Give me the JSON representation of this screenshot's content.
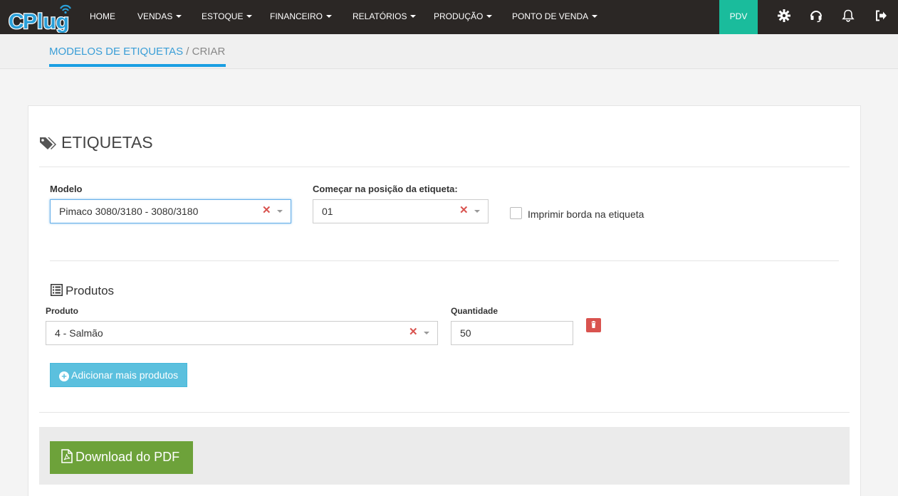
{
  "brand": {
    "logo_text": "CPlug"
  },
  "nav": {
    "items": [
      {
        "label": "HOME",
        "dropdown": false
      },
      {
        "label": "VENDAS",
        "dropdown": true
      },
      {
        "label": "ESTOQUE",
        "dropdown": true
      },
      {
        "label": "FINANCEIRO",
        "dropdown": true
      },
      {
        "label": "RELATÓRIOS",
        "dropdown": true
      },
      {
        "label": "PRODUÇÃO",
        "dropdown": true
      },
      {
        "label": "PONTO DE VENDA",
        "dropdown": true
      }
    ],
    "pdv_label": "PDV",
    "icons": [
      "gear-icon",
      "headset-icon",
      "bell-icon",
      "logout-icon"
    ]
  },
  "breadcrumb": {
    "parent": "MODELOS DE ETIQUETAS",
    "separator": " / ",
    "current": "CRIAR"
  },
  "section": {
    "title": "ETIQUETAS",
    "icon": "tags-icon"
  },
  "form": {
    "modelo_label": "Modelo",
    "modelo_value": "Pimaco 3080/3180 - 3080/3180",
    "posicao_label": "Começar na posição da etiqueta:",
    "posicao_value": "01",
    "borda_label": "Imprimir borda na etiqueta",
    "borda_checked": false
  },
  "produtos": {
    "title": "Produtos",
    "icon": "list-icon",
    "produto_label": "Produto",
    "quantidade_label": "Quantidade",
    "rows": [
      {
        "produto": "4 - Salmão",
        "quantidade": "50"
      }
    ],
    "add_label": "Adicionar mais produtos"
  },
  "actions": {
    "download_label": "Download do PDF"
  },
  "colors": {
    "navbar": "#2b2725",
    "pdv": "#1abc9c",
    "accent": "#1a9ee2",
    "info": "#5bc0de",
    "danger": "#d9534f",
    "success": "#6da23a"
  }
}
